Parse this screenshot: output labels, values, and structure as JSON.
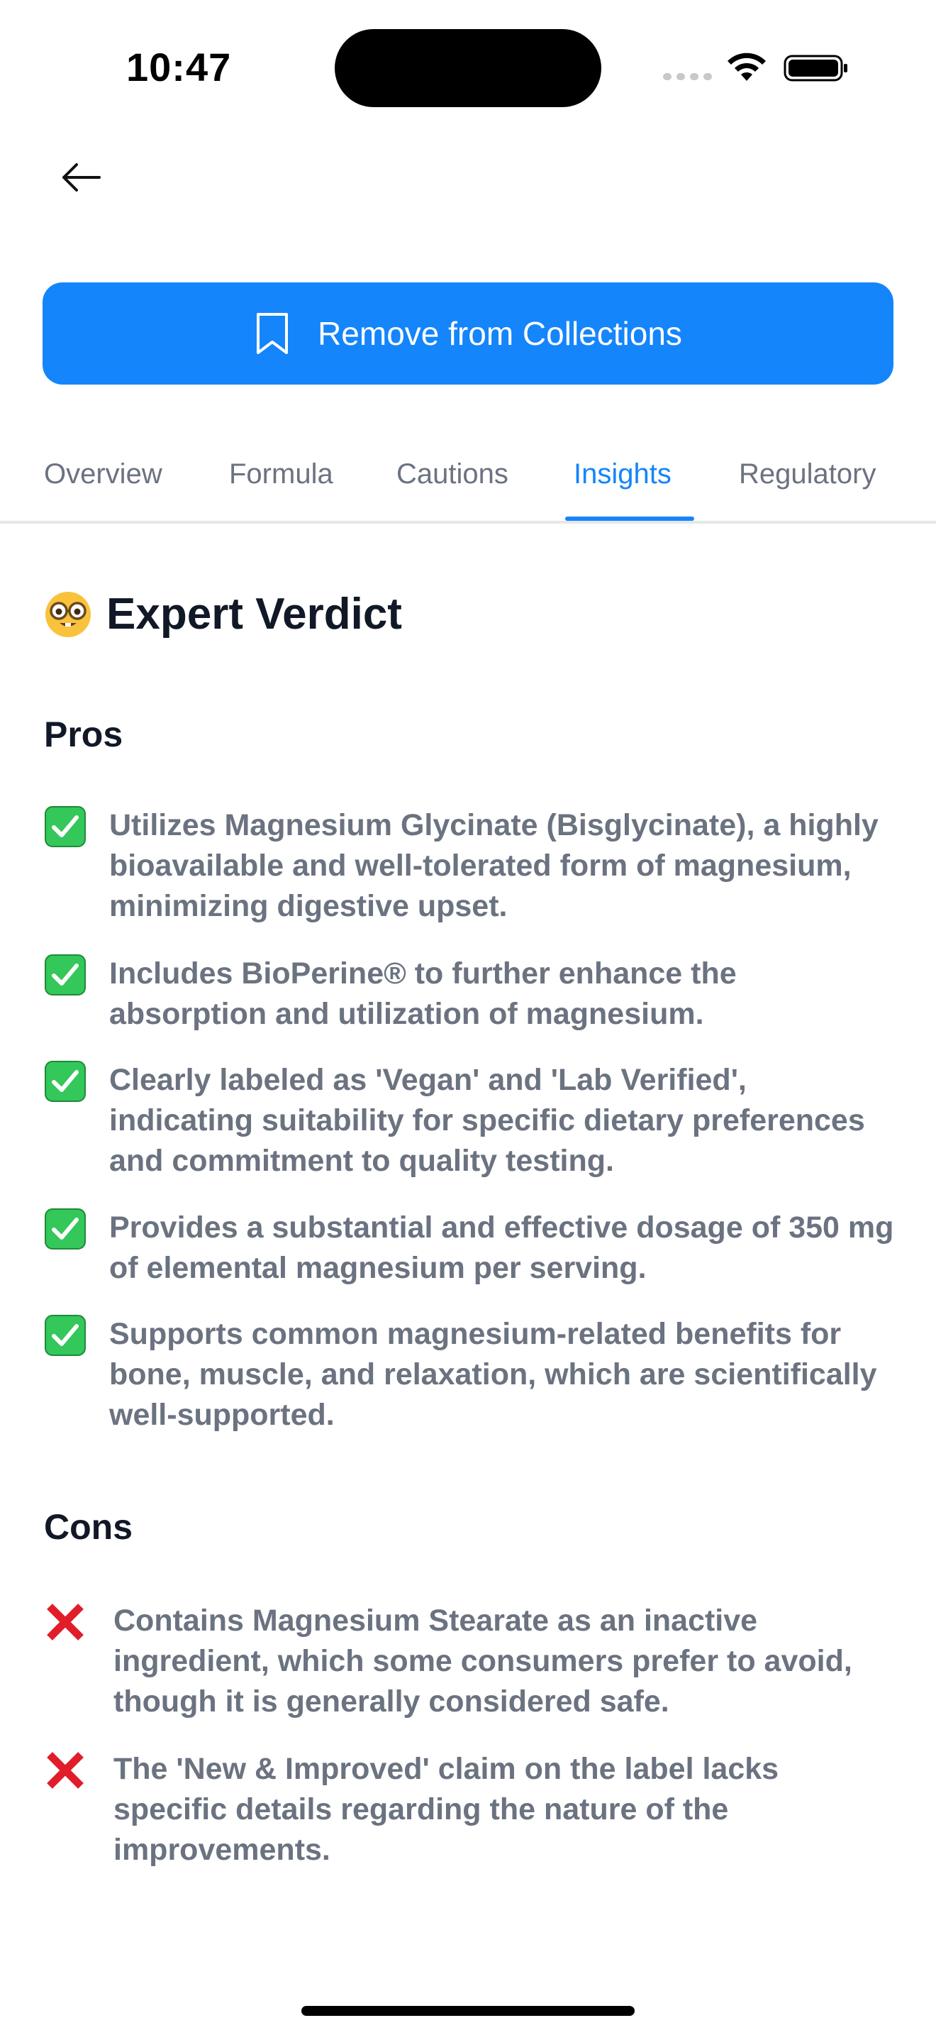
{
  "status_bar": {
    "time": "10:47"
  },
  "header": {
    "back_icon": "arrow-left-icon"
  },
  "collection_button": {
    "label": "Remove from Collections",
    "icon": "bookmark-icon",
    "color": "#1485fb"
  },
  "tabs": [
    {
      "label": "Overview",
      "active": false
    },
    {
      "label": "Formula",
      "active": false
    },
    {
      "label": "Cautions",
      "active": false
    },
    {
      "label": "Insights",
      "active": true
    },
    {
      "label": "Regulatory",
      "active": false
    }
  ],
  "verdict": {
    "emoji": "nerd-face-icon",
    "title": "Expert Verdict"
  },
  "pros": {
    "heading": "Pros",
    "marker_icon": "check-box-icon",
    "items": [
      {
        "text": "Utilizes Magnesium Glycinate (Bisglycinate), a highly bioavailable and well-tolerated form of magnesium, minimizing digestive upset."
      },
      {
        "text": "Includes BioPerine® to further enhance the absorption and utilization of magnesium."
      },
      {
        "text": "Clearly labeled as 'Vegan' and 'Lab Verified', indicating suitability for specific dietary preferences and commitment to quality testing."
      },
      {
        "text": "Provides a substantial and effective dosage of 350 mg of elemental magnesium per serving."
      },
      {
        "text": "Supports common magnesium-related benefits for bone, muscle, and relaxation, which are scientifically well-supported."
      }
    ]
  },
  "cons": {
    "heading": "Cons",
    "marker_icon": "cross-mark-icon",
    "items": [
      {
        "text": "Contains Magnesium Stearate as an inactive ingredient, which some consumers prefer to avoid, though it is generally considered safe."
      },
      {
        "text": "The 'New & Improved' claim on the label lacks specific details regarding the nature of the improvements."
      }
    ]
  },
  "colors": {
    "accent": "#1485fb",
    "pro_green": "#34c759",
    "con_red": "#e11d2a",
    "muted_text": "#6b7280"
  }
}
